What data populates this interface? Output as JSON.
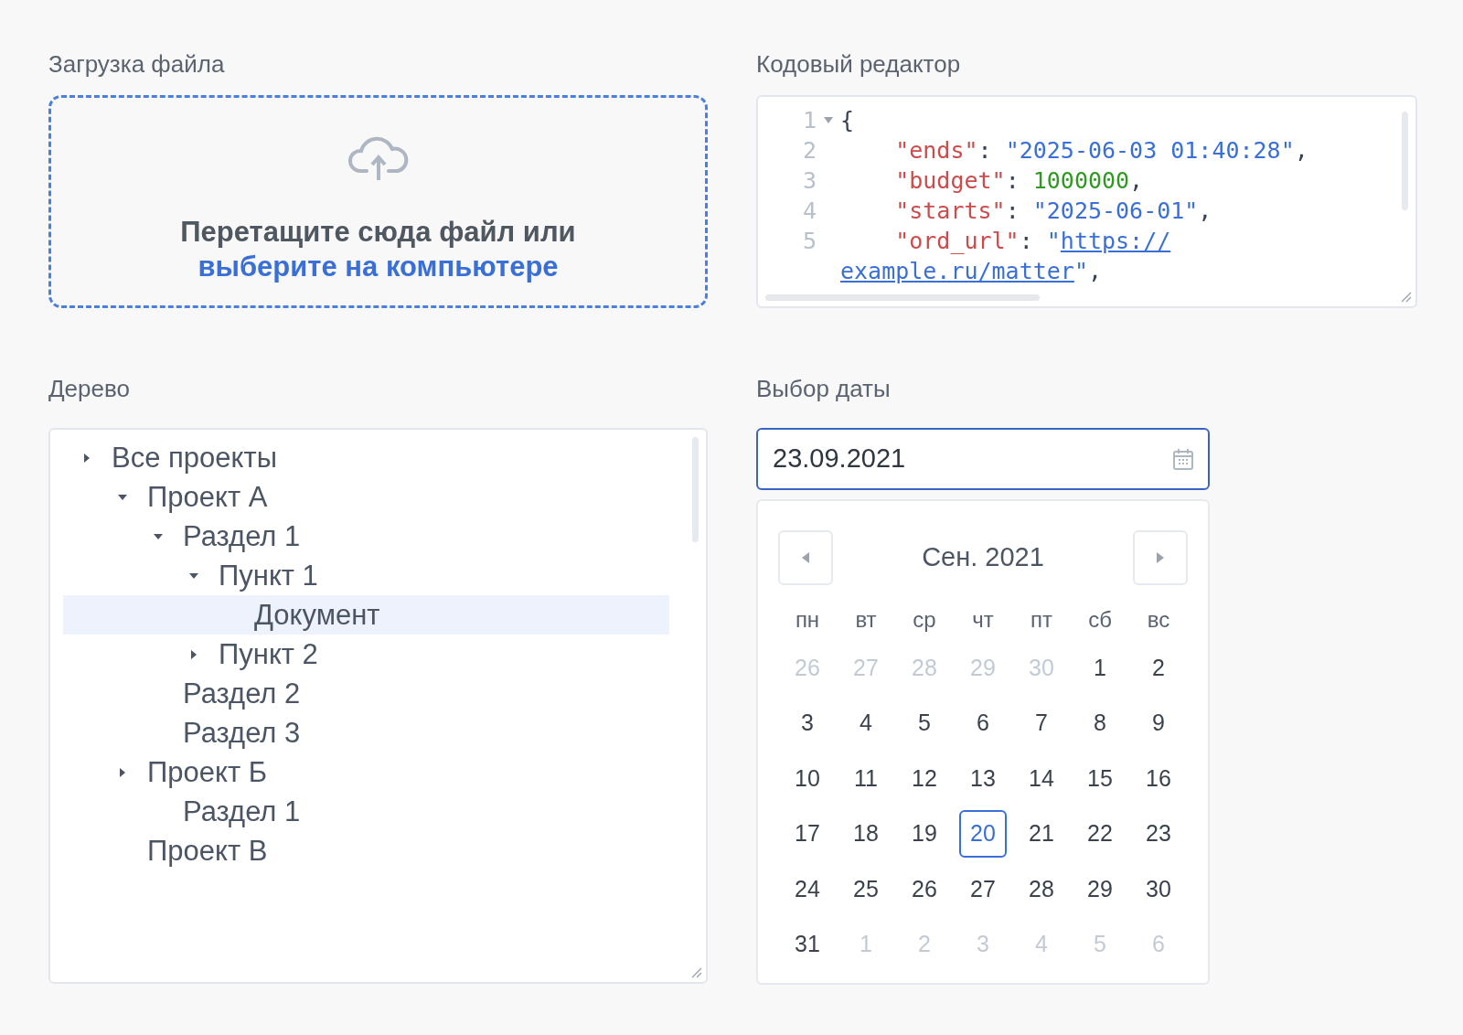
{
  "upload": {
    "label": "Загрузка файла",
    "text": "Перетащите сюда файл или",
    "link": "выберите на компьютере"
  },
  "code_editor": {
    "label": "Кодовый редактор",
    "lines": [
      {
        "number": "1",
        "foldable": true,
        "tokens": [
          {
            "kind": "punct",
            "text": "{"
          }
        ]
      },
      {
        "number": "2",
        "tokens": [
          {
            "kind": "key",
            "text": "    \"ends\""
          },
          {
            "kind": "punct",
            "text": ": "
          },
          {
            "kind": "string",
            "text": "\"2025-06-03 01:40:28\""
          },
          {
            "kind": "punct",
            "text": ","
          }
        ]
      },
      {
        "number": "3",
        "tokens": [
          {
            "kind": "key",
            "text": "    \"budget\""
          },
          {
            "kind": "punct",
            "text": ": "
          },
          {
            "kind": "number",
            "text": "1000000"
          },
          {
            "kind": "punct",
            "text": ","
          }
        ]
      },
      {
        "number": "4",
        "tokens": [
          {
            "kind": "key",
            "text": "    \"starts\""
          },
          {
            "kind": "punct",
            "text": ": "
          },
          {
            "kind": "string",
            "text": "\"2025-06-01\""
          },
          {
            "kind": "punct",
            "text": ","
          }
        ]
      },
      {
        "number": "5",
        "tokens": [
          {
            "kind": "key",
            "text": "    \"ord_url\""
          },
          {
            "kind": "punct",
            "text": ": "
          },
          {
            "kind": "string",
            "text": "\""
          },
          {
            "kind": "link",
            "text": "https://"
          }
        ]
      },
      {
        "tokens": [
          {
            "kind": "link",
            "text": "example.ru/matter"
          },
          {
            "kind": "string",
            "text": "\""
          },
          {
            "kind": "punct",
            "text": ","
          }
        ]
      }
    ]
  },
  "tree": {
    "label": "Дерево",
    "items": [
      {
        "label": "Все проекты",
        "expanded": false,
        "selected": false,
        "children": [
          {
            "label": "Проект А",
            "expanded": true,
            "selected": false,
            "children": [
              {
                "label": "Раздел 1",
                "expanded": true,
                "selected": false,
                "children": [
                  {
                    "label": "Пункт 1",
                    "expanded": true,
                    "selected": false,
                    "children": [
                      {
                        "label": "Документ",
                        "selected": true
                      }
                    ]
                  },
                  {
                    "label": "Пункт 2",
                    "expanded": false,
                    "selected": false
                  }
                ]
              },
              {
                "label": "Раздел 2",
                "selected": false
              },
              {
                "label": "Раздел 3",
                "selected": false
              }
            ]
          },
          {
            "label": "Проект Б",
            "expanded": false,
            "selected": false,
            "children": [
              {
                "label": "Раздел 1",
                "selected": false
              }
            ]
          },
          {
            "label": "Проект В",
            "selected": false
          }
        ]
      }
    ]
  },
  "date_picker": {
    "label": "Выбор даты",
    "value": "23.09.2021",
    "focused": true,
    "month": "Сен. 2021",
    "weekdays": [
      "пн",
      "вт",
      "ср",
      "чт",
      "пт",
      "сб",
      "вс"
    ],
    "weeks": [
      [
        {
          "day": "26",
          "outside": true,
          "selected": false
        },
        {
          "day": "27",
          "outside": true,
          "selected": false
        },
        {
          "day": "28",
          "outside": true,
          "selected": false
        },
        {
          "day": "29",
          "outside": true,
          "selected": false
        },
        {
          "day": "30",
          "outside": true,
          "selected": false
        },
        {
          "day": "1",
          "outside": false,
          "selected": false
        },
        {
          "day": "2",
          "outside": false,
          "selected": false
        }
      ],
      [
        {
          "day": "3",
          "outside": false,
          "selected": false
        },
        {
          "day": "4",
          "outside": false,
          "selected": false
        },
        {
          "day": "5",
          "outside": false,
          "selected": false
        },
        {
          "day": "6",
          "outside": false,
          "selected": false
        },
        {
          "day": "7",
          "outside": false,
          "selected": false
        },
        {
          "day": "8",
          "outside": false,
          "selected": false
        },
        {
          "day": "9",
          "outside": false,
          "selected": false
        }
      ],
      [
        {
          "day": "10",
          "outside": false,
          "selected": false
        },
        {
          "day": "11",
          "outside": false,
          "selected": false
        },
        {
          "day": "12",
          "outside": false,
          "selected": false
        },
        {
          "day": "13",
          "outside": false,
          "selected": false
        },
        {
          "day": "14",
          "outside": false,
          "selected": false
        },
        {
          "day": "15",
          "outside": false,
          "selected": false
        },
        {
          "day": "16",
          "outside": false,
          "selected": false
        }
      ],
      [
        {
          "day": "17",
          "outside": false,
          "selected": false
        },
        {
          "day": "18",
          "outside": false,
          "selected": false
        },
        {
          "day": "19",
          "outside": false,
          "selected": false
        },
        {
          "day": "20",
          "outside": false,
          "selected": true
        },
        {
          "day": "21",
          "outside": false,
          "selected": false
        },
        {
          "day": "22",
          "outside": false,
          "selected": false
        },
        {
          "day": "23",
          "outside": false,
          "selected": false
        }
      ],
      [
        {
          "day": "24",
          "outside": false,
          "selected": false
        },
        {
          "day": "25",
          "outside": false,
          "selected": false
        },
        {
          "day": "26",
          "outside": false,
          "selected": false
        },
        {
          "day": "27",
          "outside": false,
          "selected": false
        },
        {
          "day": "28",
          "outside": false,
          "selected": false
        },
        {
          "day": "29",
          "outside": false,
          "selected": false
        },
        {
          "day": "30",
          "outside": false,
          "selected": false
        }
      ],
      [
        {
          "day": "31",
          "outside": false,
          "selected": false
        },
        {
          "day": "1",
          "outside": true,
          "selected": false
        },
        {
          "day": "2",
          "outside": true,
          "selected": false
        },
        {
          "day": "3",
          "outside": true,
          "selected": false
        },
        {
          "day": "4",
          "outside": true,
          "selected": false
        },
        {
          "day": "5",
          "outside": true,
          "selected": false
        },
        {
          "day": "6",
          "outside": true,
          "selected": false
        }
      ]
    ]
  }
}
